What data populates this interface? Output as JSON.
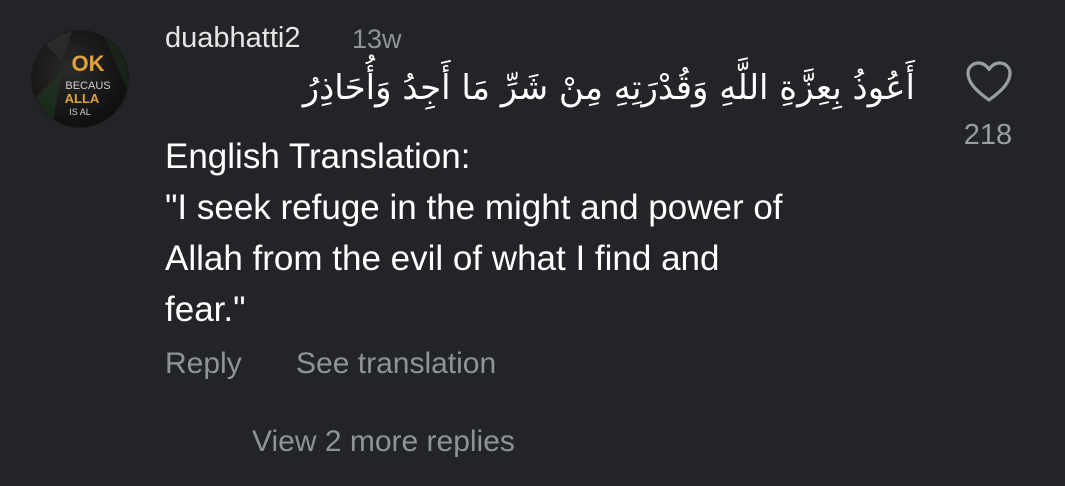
{
  "comment": {
    "username": "duabhatti2",
    "time": "13w",
    "arabic_text": "أَعُوذُ بِعِزَّةِ اللَّهِ وَقُدْرَتِهِ مِنْ شَرِّ مَا أَجِدُ وَأُحَاذِرُ",
    "body_lines": [
      "English Translation:",
      "\"I seek refuge in the might and power of",
      "Allah from the evil of what I find and",
      "fear.\""
    ],
    "like_count": "218",
    "actions": {
      "reply": "Reply",
      "see_translation": "See translation"
    },
    "view_replies": "View 2 more replies"
  },
  "avatar": {
    "text_lines": [
      "OK",
      "BECAUS",
      "ALLA",
      "IS AL"
    ]
  },
  "icons": {
    "like": "heart-outline-icon"
  },
  "colors": {
    "background": "#232427",
    "primary_text": "#ffffff",
    "secondary_text": "#8f9398",
    "avatar_accent": "#e0a13a"
  }
}
